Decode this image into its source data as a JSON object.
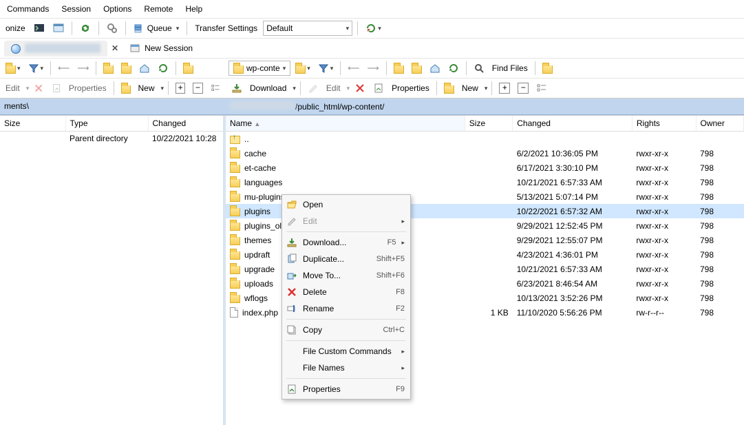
{
  "menubar": {
    "commands": "Commands",
    "session": "Session",
    "options": "Options",
    "remote": "Remote",
    "help": "Help"
  },
  "toolbar1": {
    "onize": "onize",
    "queue": "Queue",
    "transfer_label": "Transfer Settings",
    "transfer_value": "Default"
  },
  "tabs": {
    "new_session": "New Session"
  },
  "pane_toolbar": {
    "findfiles": "Find Files",
    "remote_combo": "wp-conte",
    "edit": "Edit",
    "new": "New",
    "properties": "Properties",
    "download": "Download"
  },
  "left": {
    "path": "ments\\",
    "cols": {
      "size": "Size",
      "type": "Type",
      "changed": "Changed"
    },
    "rows": [
      {
        "type": "Parent directory",
        "changed": "10/22/2021  10:28"
      }
    ]
  },
  "right": {
    "path_prefix": "/public_html/wp-content/",
    "cols": {
      "name": "Name",
      "size": "Size",
      "changed": "Changed",
      "rights": "Rights",
      "owner": "Owner"
    },
    "rows": [
      {
        "name": "..",
        "kind": "up"
      },
      {
        "name": "cache",
        "kind": "folder",
        "changed": "6/2/2021 10:36:05 PM",
        "rights": "rwxr-xr-x",
        "owner": "798"
      },
      {
        "name": "et-cache",
        "kind": "folder",
        "changed": "6/17/2021 3:30:10 PM",
        "rights": "rwxr-xr-x",
        "owner": "798"
      },
      {
        "name": "languages",
        "kind": "folder",
        "changed": "10/21/2021 6:57:33 AM",
        "rights": "rwxr-xr-x",
        "owner": "798"
      },
      {
        "name": "mu-plugins",
        "kind": "folder",
        "changed": "5/13/2021 5:07:14 PM",
        "rights": "rwxr-xr-x",
        "owner": "798"
      },
      {
        "name": "plugins",
        "kind": "folder",
        "changed": "10/22/2021 6:57:32 AM",
        "rights": "rwxr-xr-x",
        "owner": "798",
        "sel": true
      },
      {
        "name": "plugins_old",
        "kind": "folder",
        "changed": "9/29/2021 12:52:45 PM",
        "rights": "rwxr-xr-x",
        "owner": "798"
      },
      {
        "name": "themes",
        "kind": "folder",
        "changed": "9/29/2021 12:55:07 PM",
        "rights": "rwxr-xr-x",
        "owner": "798"
      },
      {
        "name": "updraft",
        "kind": "folder",
        "changed": "4/23/2021 4:36:01 PM",
        "rights": "rwxr-xr-x",
        "owner": "798"
      },
      {
        "name": "upgrade",
        "kind": "folder",
        "changed": "10/21/2021 6:57:33 AM",
        "rights": "rwxr-xr-x",
        "owner": "798"
      },
      {
        "name": "uploads",
        "kind": "folder",
        "changed": "6/23/2021 8:46:54 AM",
        "rights": "rwxr-xr-x",
        "owner": "798"
      },
      {
        "name": "wflogs",
        "kind": "folder",
        "changed": "10/13/2021 3:52:26 PM",
        "rights": "rwxr-xr-x",
        "owner": "798"
      },
      {
        "name": "index.php",
        "kind": "file",
        "size": "1 KB",
        "changed": "11/10/2020 5:56:26 PM",
        "rights": "rw-r--r--",
        "owner": "798"
      }
    ]
  },
  "ctx": [
    {
      "label": "Open",
      "icon": "open"
    },
    {
      "label": "Edit",
      "icon": "edit",
      "disabled": true,
      "sub": true
    },
    {
      "sep": true
    },
    {
      "label": "Download...",
      "icon": "download",
      "key": "F5",
      "sub": true
    },
    {
      "label": "Duplicate...",
      "icon": "dup",
      "key": "Shift+F5"
    },
    {
      "label": "Move To...",
      "icon": "move",
      "key": "Shift+F6"
    },
    {
      "label": "Delete",
      "icon": "delete",
      "key": "F8"
    },
    {
      "label": "Rename",
      "icon": "rename",
      "key": "F2"
    },
    {
      "sep": true
    },
    {
      "label": "Copy",
      "icon": "copy",
      "key": "Ctrl+C"
    },
    {
      "sep": true
    },
    {
      "label": "File Custom Commands",
      "sub": true
    },
    {
      "label": "File Names",
      "sub": true
    },
    {
      "sep": true
    },
    {
      "label": "Properties",
      "icon": "props",
      "key": "F9"
    }
  ]
}
